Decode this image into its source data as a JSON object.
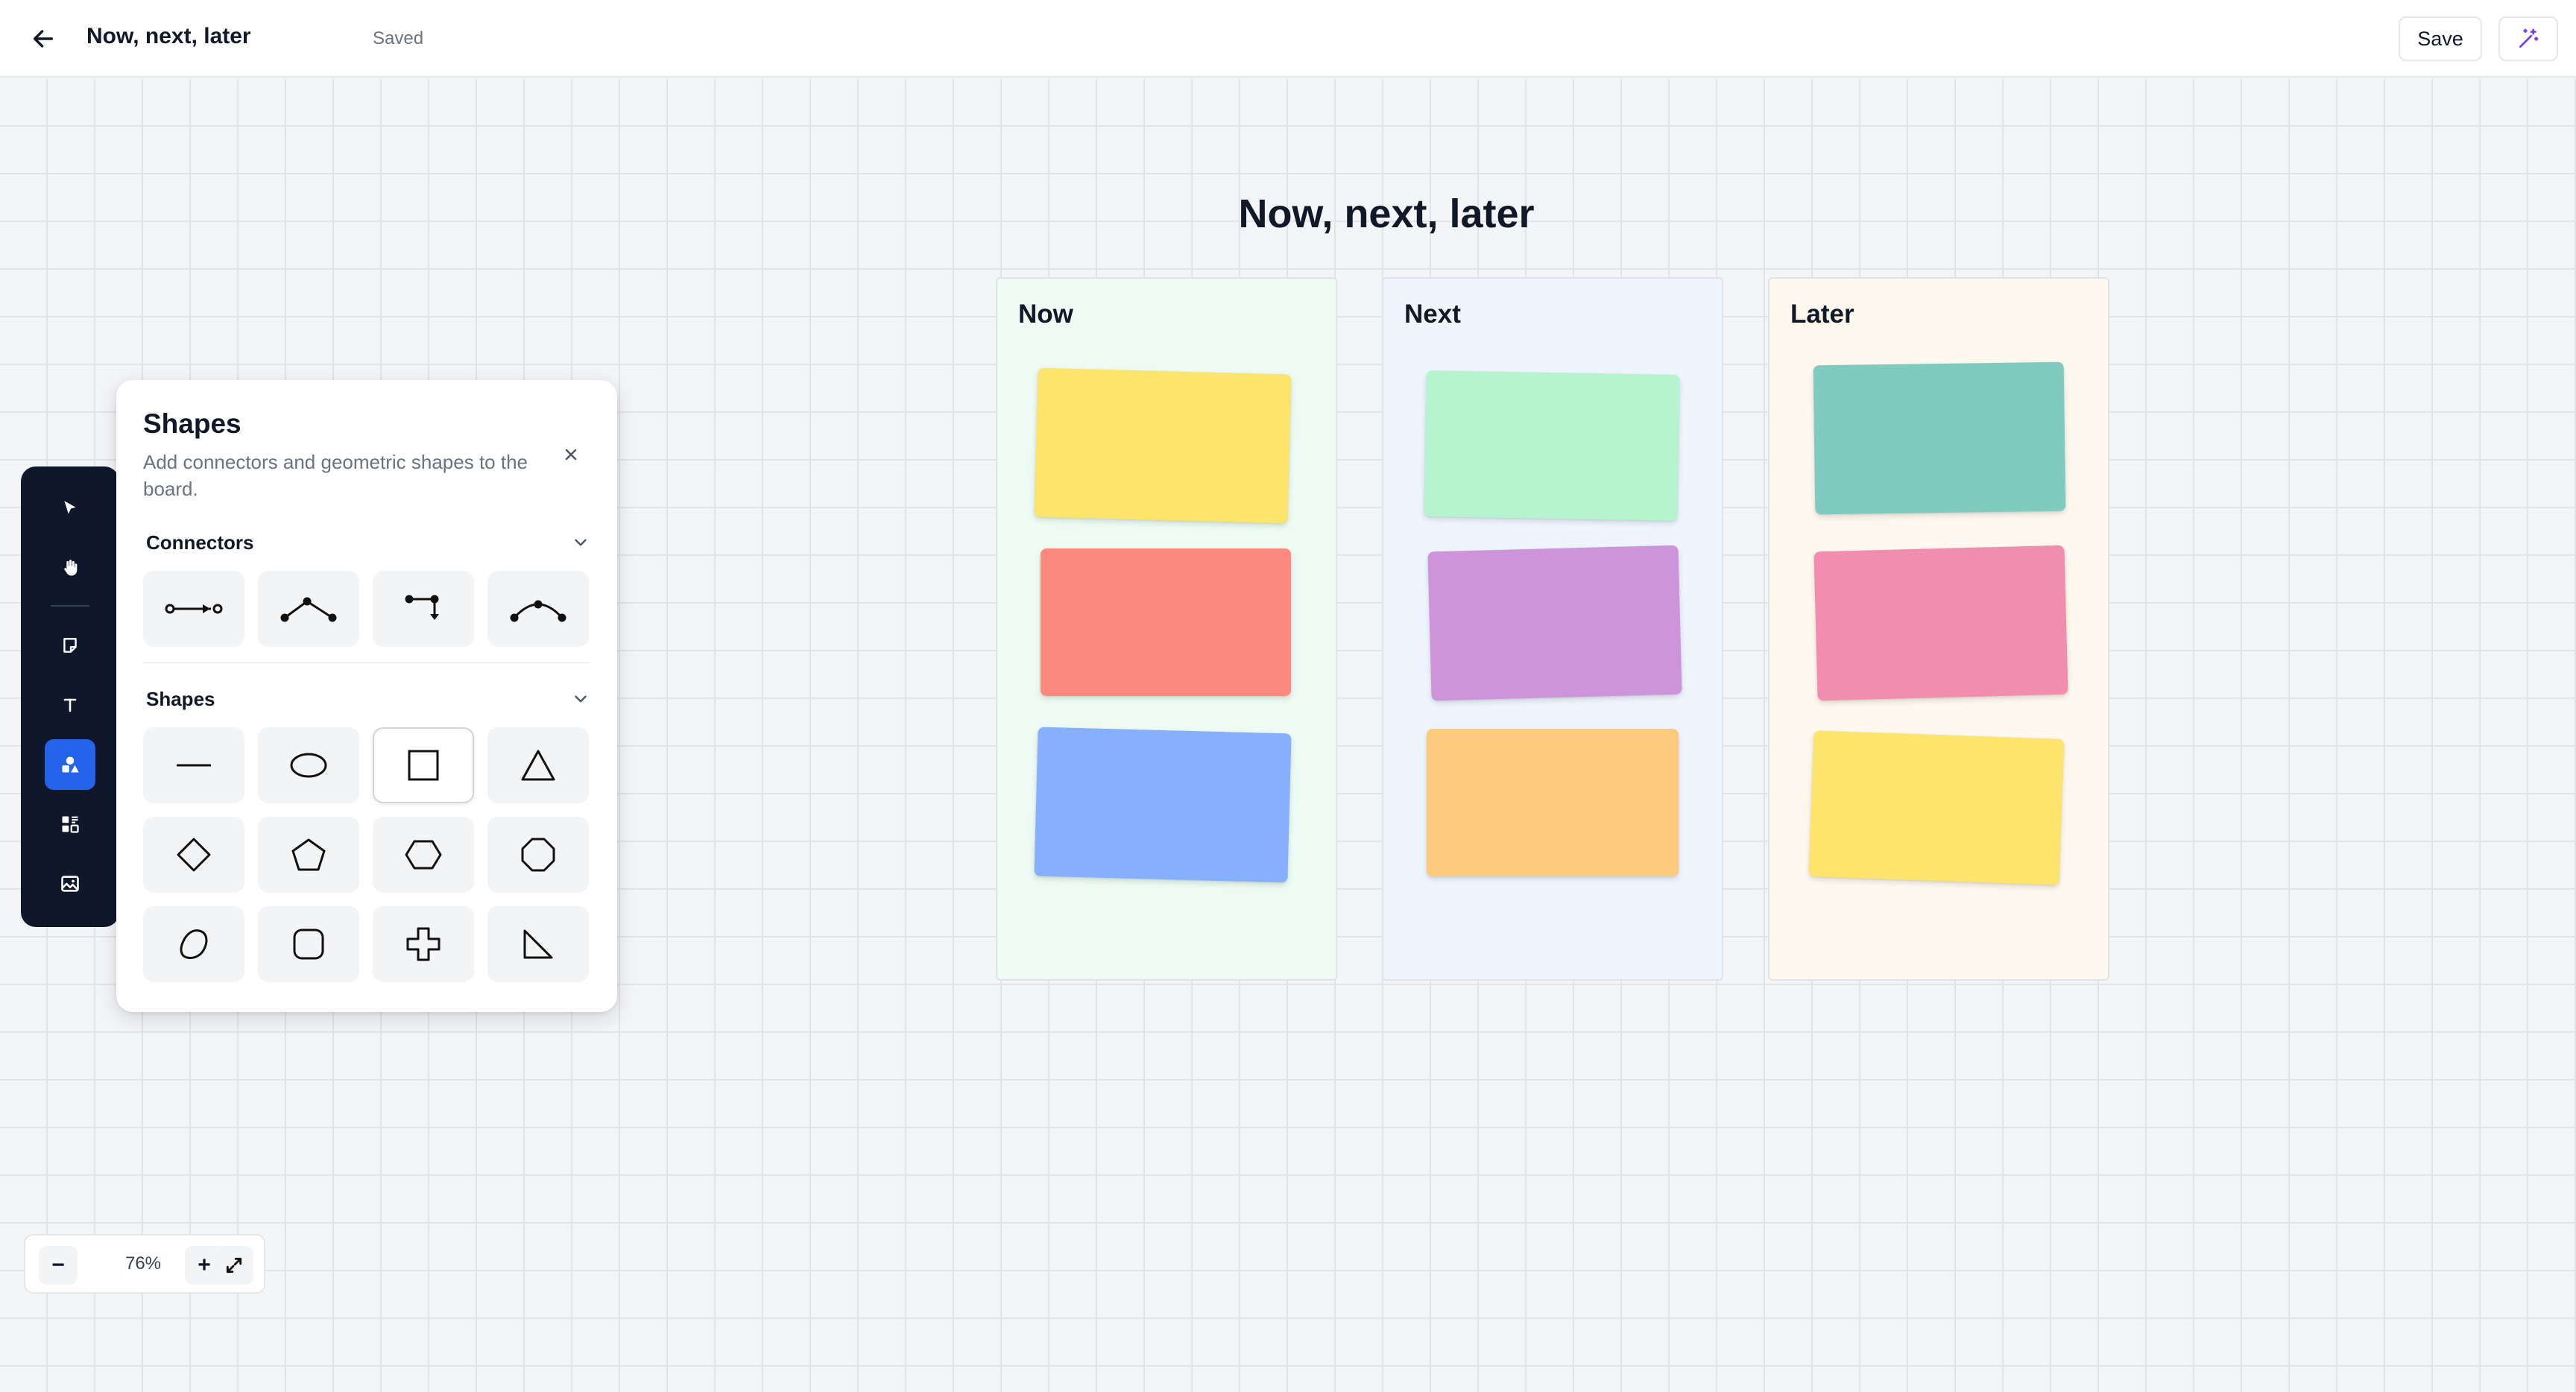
{
  "header": {
    "title": "Now, next, later",
    "status": "Saved",
    "save_label": "Save",
    "back_icon": "arrow-left-icon",
    "magic_icon": "magic-wand-icon"
  },
  "board": {
    "title": "Now, next, later",
    "columns": [
      {
        "title": "Now",
        "background": "#edfbf4",
        "notes": [
          "#fde46d",
          "#fd8a7f",
          "#86b0fc"
        ]
      },
      {
        "title": "Next",
        "background": "#eef5fe",
        "notes": [
          "#b6f4cf",
          "#cd94d9",
          "#fdca7e"
        ]
      },
      {
        "title": "Later",
        "background": "#fef8ee",
        "notes": [
          "#7fcbc0",
          "#f28db0",
          "#fde46d"
        ]
      }
    ]
  },
  "toolbar": {
    "tools": [
      "select-icon",
      "hand-icon",
      "sticky-note-icon",
      "text-icon",
      "shapes-icon",
      "templates-icon",
      "image-icon"
    ],
    "active": "shapes-icon",
    "accent": "#2563eb"
  },
  "shapes_panel": {
    "title": "Shapes",
    "description": "Add connectors and geometric shapes to the board.",
    "connectors_label": "Connectors",
    "shapes_label": "Shapes",
    "connectors": [
      "straight-connector",
      "elbow-angled-connector",
      "step-connector",
      "curved-connector"
    ],
    "shapes": [
      "line",
      "ellipse",
      "rectangle",
      "triangle",
      "diamond",
      "pentagon",
      "hexagon",
      "octagon",
      "blob",
      "rounded-rectangle",
      "cross",
      "right-triangle"
    ],
    "selected_shape": "rectangle"
  },
  "zoom": {
    "level": "76%",
    "minus_label": "−",
    "plus_label": "+"
  }
}
